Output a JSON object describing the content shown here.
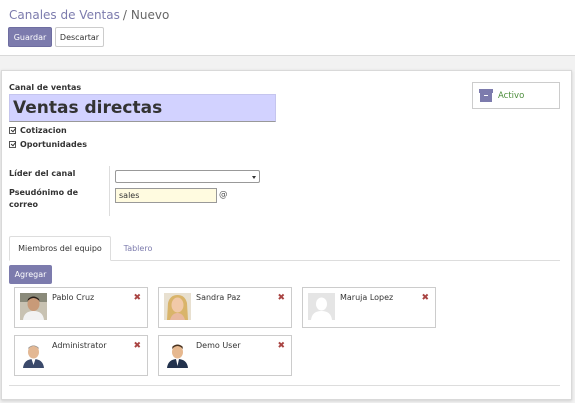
{
  "breadcrumb": {
    "parent": "Canales de Ventas",
    "separator": "/",
    "current": "Nuevo"
  },
  "toolbar": {
    "save_label": "Guardar",
    "discard_label": "Descartar"
  },
  "button_box": {
    "active_label": "Activo",
    "icon": "archive-icon"
  },
  "form": {
    "team_label": "Canal de ventas",
    "team_name": "Ventas directas",
    "checkboxes": [
      {
        "label": "Cotizacion",
        "checked": true
      },
      {
        "label": "Oportunidades",
        "checked": true
      }
    ],
    "leader_label": "Líder del canal",
    "leader_value": "",
    "alias_label_line1": "Pseudónimo de",
    "alias_label_line2": "correo",
    "alias_value": "sales",
    "alias_suffix": "@"
  },
  "tabs": [
    {
      "label": "Miembros del equipo",
      "active": true
    },
    {
      "label": "Tablero",
      "active": false
    }
  ],
  "members": {
    "add_label": "Agregar",
    "remove_glyph": "✖",
    "list": [
      {
        "name": "Pablo Cruz",
        "avatar": "photo-man-dark"
      },
      {
        "name": "Sandra Paz",
        "avatar": "photo-woman-blonde"
      },
      {
        "name": "Maruja Lopez",
        "avatar": "placeholder-silhouette"
      },
      {
        "name": "Administrator",
        "avatar": "photo-man-grey"
      },
      {
        "name": "Demo User",
        "avatar": "photo-man-suit"
      }
    ]
  },
  "colors": {
    "brand": "#7c7bad",
    "name_highlight": "#d2d2ff",
    "remove": "#a94442",
    "active": "#4c8d3b"
  }
}
